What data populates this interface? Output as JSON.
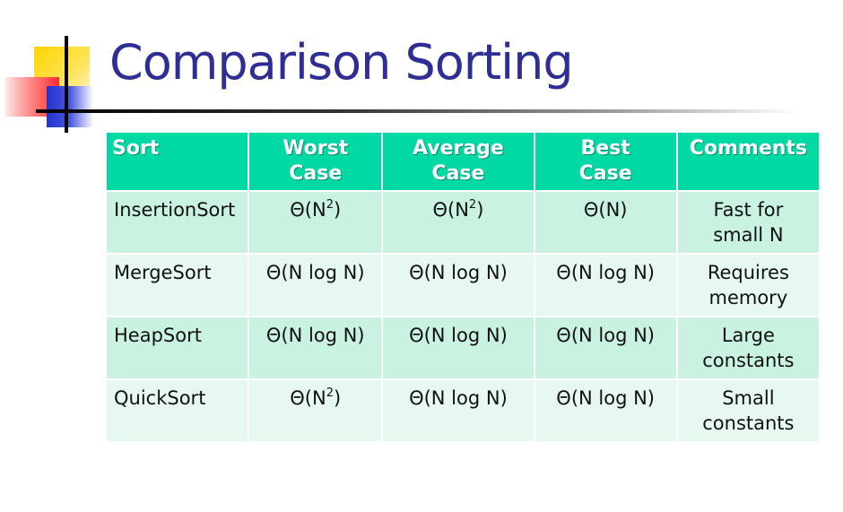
{
  "slide": {
    "title": "Comparison Sorting"
  },
  "table": {
    "headers": [
      "Sort",
      "Worst Case",
      "Average Case",
      "Best Case",
      "Comments"
    ],
    "rows": [
      {
        "sort": "InsertionSort",
        "worst_base": "Θ(N",
        "worst_sup": "2",
        "worst_end": ")",
        "average_base": "Θ(N",
        "average_sup": "2",
        "average_end": ")",
        "best": "Θ(N)",
        "comments": "Fast for small N"
      },
      {
        "sort": "MergeSort",
        "worst": "Θ(N log N)",
        "average": "Θ(N log N)",
        "best": "Θ(N log N)",
        "comments": "Requires memory"
      },
      {
        "sort": "HeapSort",
        "worst": "Θ(N log N)",
        "average": "Θ(N log N)",
        "best": "Θ(N log N)",
        "comments": "Large constants"
      },
      {
        "sort": "QuickSort",
        "worst_base": "Θ(N",
        "worst_sup": "2",
        "worst_end": ")",
        "average": "Θ(N log N)",
        "best": "Θ(N log N)",
        "comments": "Small constants"
      }
    ]
  },
  "colors": {
    "title": "#2e2e96",
    "header_bg": "#00d9a3",
    "row_odd": "#c9f2e1",
    "row_even": "#e6f8f0"
  }
}
